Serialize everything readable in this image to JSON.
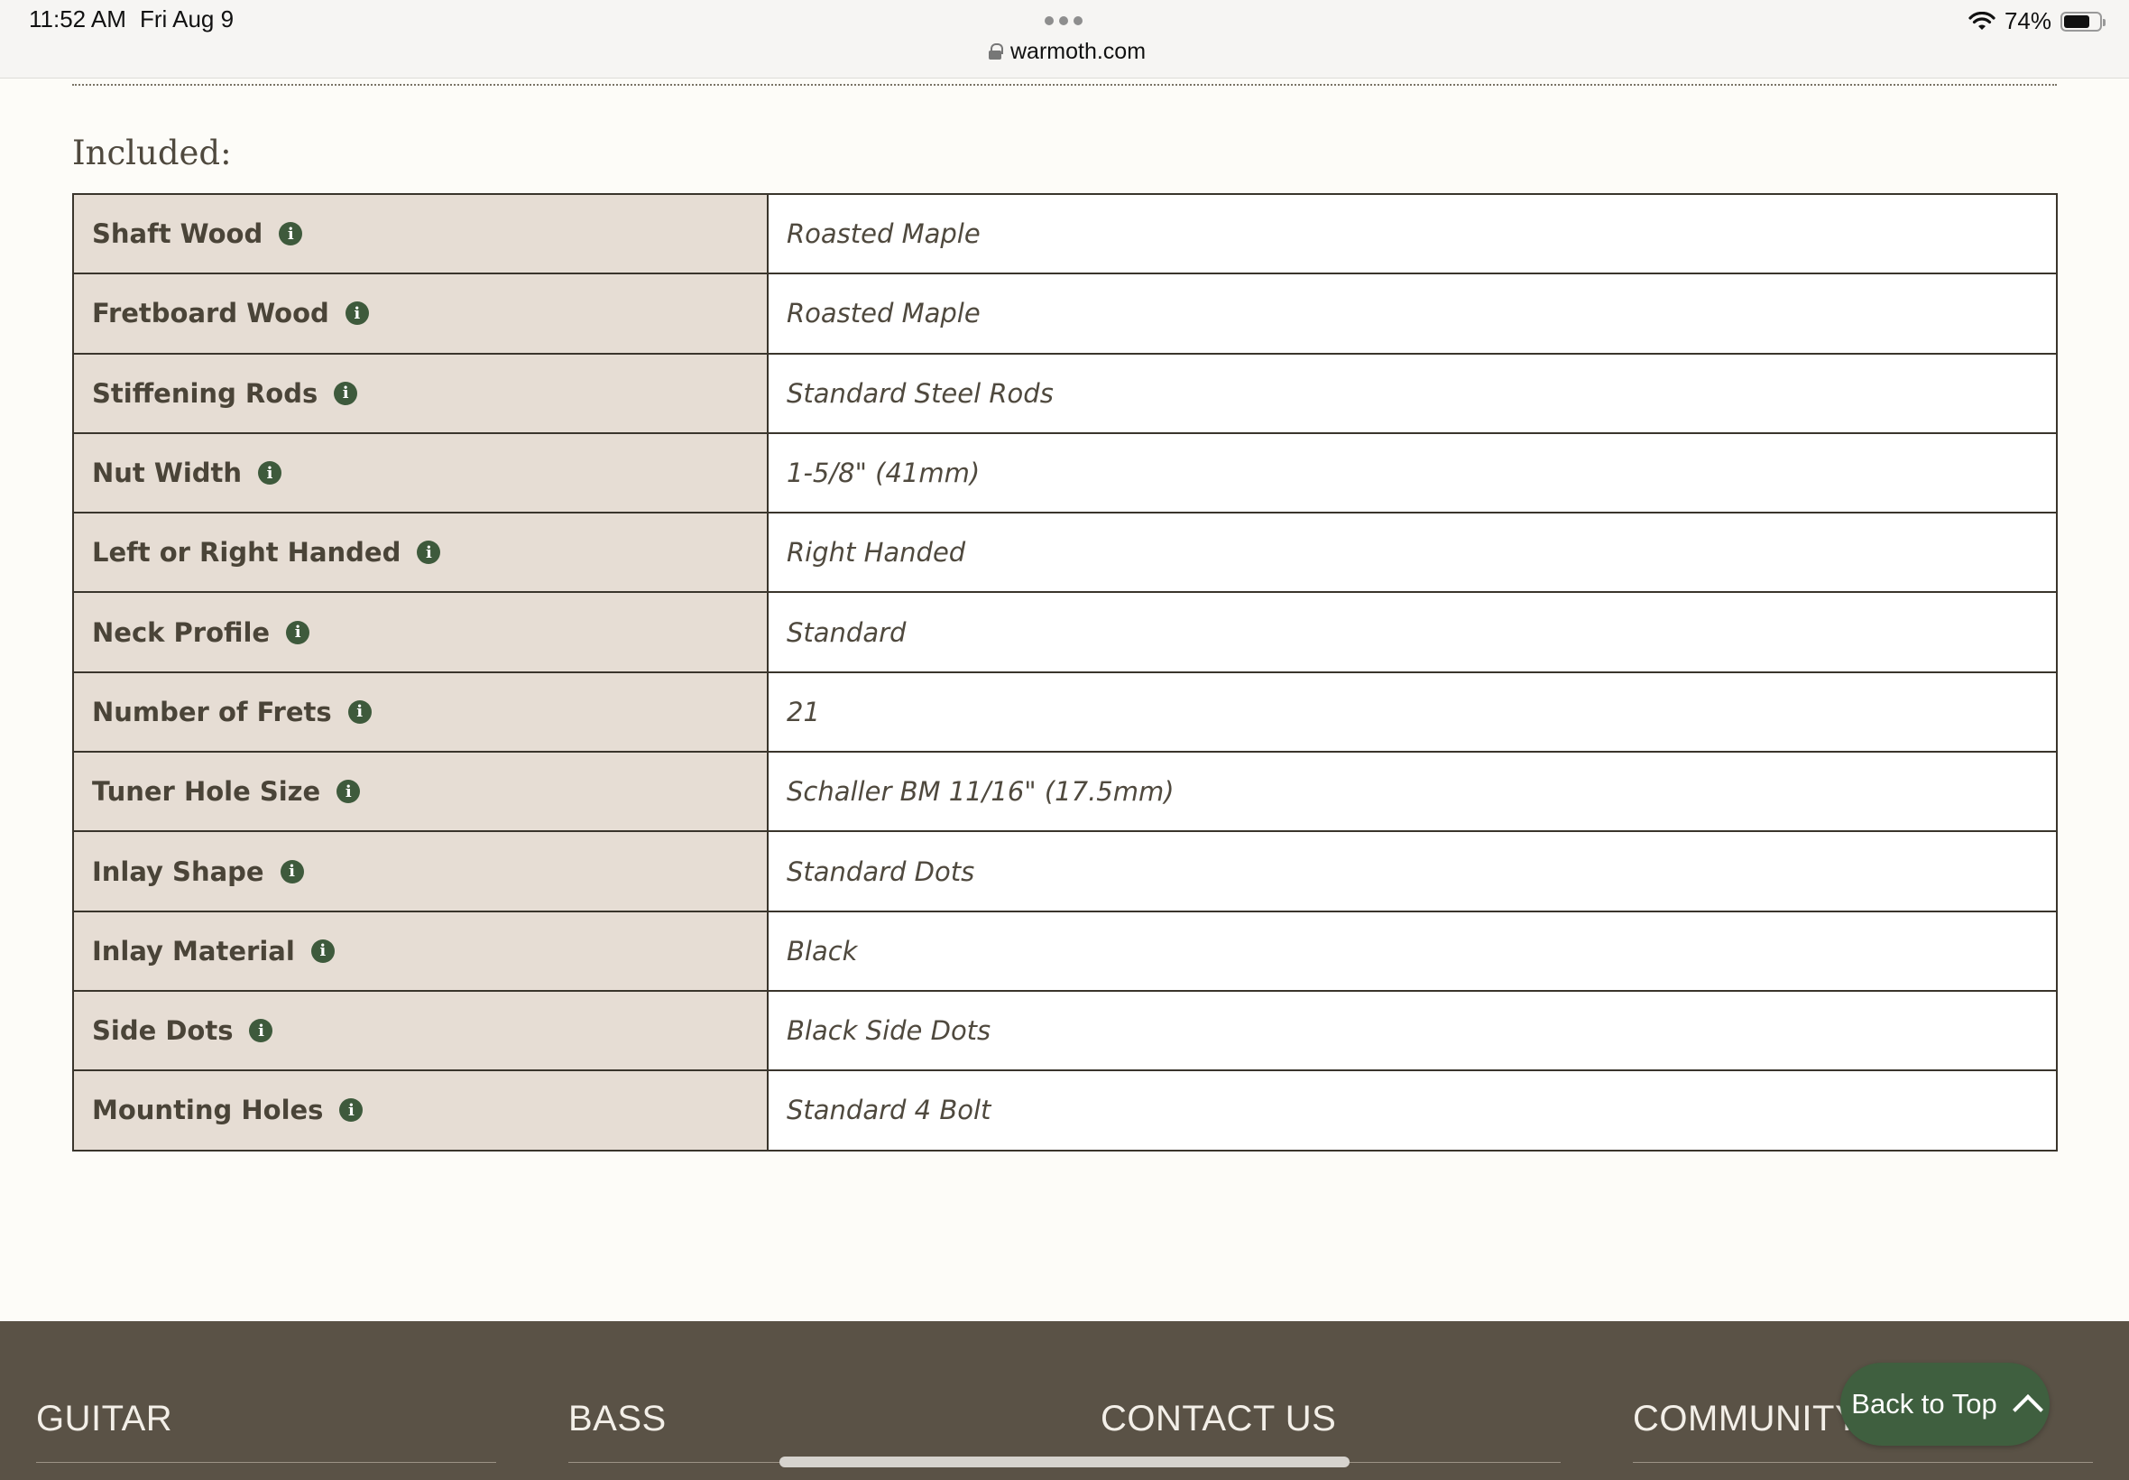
{
  "status_bar": {
    "time": "11:52 AM",
    "date": "Fri Aug 9",
    "url": "warmoth.com",
    "battery": "74%",
    "battery_level": 0.74
  },
  "section": {
    "heading": "Included:"
  },
  "specs": [
    {
      "label": "Shaft Wood",
      "value": "Roasted Maple"
    },
    {
      "label": "Fretboard Wood",
      "value": "Roasted Maple"
    },
    {
      "label": "Stiffening Rods",
      "value": "Standard Steel Rods"
    },
    {
      "label": "Nut Width",
      "value": "1-5/8\" (41mm)"
    },
    {
      "label": "Left or Right Handed",
      "value": "Right Handed"
    },
    {
      "label": "Neck Profile",
      "value": "Standard"
    },
    {
      "label": "Number of Frets",
      "value": "21"
    },
    {
      "label": "Tuner Hole Size",
      "value": "Schaller BM 11/16\" (17.5mm)"
    },
    {
      "label": "Inlay Shape",
      "value": "Standard Dots"
    },
    {
      "label": "Inlay Material",
      "value": "Black"
    },
    {
      "label": "Side Dots",
      "value": "Black Side Dots"
    },
    {
      "label": "Mounting Holes",
      "value": "Standard 4 Bolt"
    }
  ],
  "info_glyph": "i",
  "footer": {
    "columns": [
      "GUITAR",
      "BASS",
      "CONTACT US",
      "COMMUNITY"
    ],
    "back_to_top": "Back to Top"
  },
  "colors": {
    "label_bg": "#e6ddd4",
    "info_icon": "#3e5a3c",
    "footer_bg": "#5a5246",
    "back_to_top_bg": "#3f5f3f"
  }
}
